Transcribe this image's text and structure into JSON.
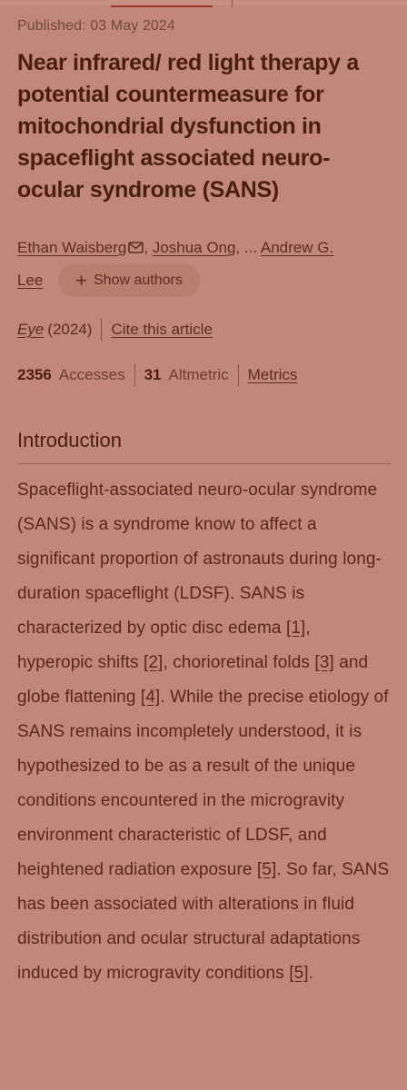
{
  "article": {
    "published": "Published: 03 May 2024",
    "title": "Near infrared/ red light therapy a potential countermeasure for mitochondrial dysfunction in spaceflight associated neuro-ocular syndrome (SANS)",
    "authors": {
      "first": "Ethan Waisberg",
      "second": "Joshua Ong",
      "ellipsis": ", ...",
      "last_part1": "Andrew G.",
      "last_part2": "Lee",
      "show_authors_label": "Show authors"
    },
    "journal": "Eye",
    "year": "(2024)",
    "cite_label": "Cite this article",
    "metrics": {
      "accesses_count": "2356",
      "accesses_label": "Accesses",
      "altmetric_count": "31",
      "altmetric_label": "Altmetric",
      "metrics_link": "Metrics"
    }
  },
  "introduction": {
    "heading": "Introduction",
    "seg1": "Spaceflight-associated neuro-ocular syndrome (SANS) is a syndrome know to affect a significant proportion of astronauts during long-duration spaceflight (LDSF). SANS is characterized by optic disc edema ",
    "ref1": "[1]",
    "seg2": ", hyperopic shifts ",
    "ref2": "[2]",
    "seg3": ", chorioretinal folds ",
    "ref3": "[3]",
    "seg4": " and globe flattening ",
    "ref4": "[4]",
    "seg5": ". While the precise etiology of SANS remains incompletely understood, it is hypothesized to be as a result of the unique conditions encountered in the microgravity environment characteristic of LDSF, and heightened radiation exposure ",
    "ref5": "[5]",
    "seg6": ". So far, SANS has been associated with alterations in fluid distribution and ocular structural adaptations induced by microgravity conditions ",
    "ref6": "[5]",
    "seg7": "."
  },
  "icons": {
    "mail": "mail-icon",
    "plus": "plus-icon"
  }
}
